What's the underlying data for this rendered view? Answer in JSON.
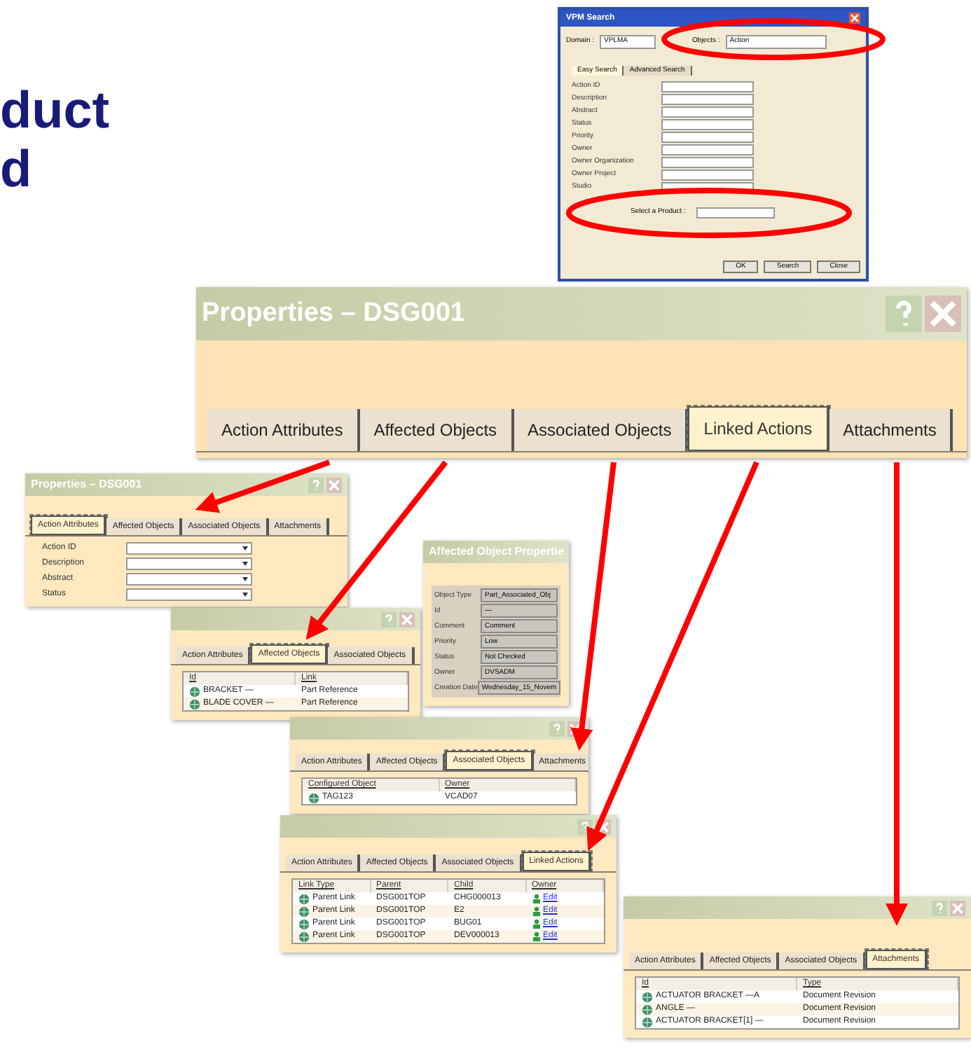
{
  "slide_title": [
    "duct",
    "d"
  ],
  "search_dialog": {
    "title": "VPM Search",
    "domain_label": "Domain :",
    "domain_value": "VPLMA",
    "objects_label": "Objects :",
    "objects_value": "Action",
    "tabs": [
      {
        "label": "Easy Search",
        "selected": true
      },
      {
        "label": "Advanced Search",
        "selected": false
      }
    ],
    "fields": [
      "Action ID",
      "Description",
      "Abstract",
      "Status",
      "Priority",
      "Owner",
      "Owner Organization",
      "Owner Project",
      "Studio"
    ],
    "product_label": "Select a Product :",
    "buttons": [
      "OK",
      "Search",
      "Close"
    ]
  },
  "windows": [
    {
      "kind": "blank",
      "title": "Properties – DSG001",
      "tabs": [
        {
          "label": "Action Attributes",
          "selected": false
        },
        {
          "label": "Affected Objects",
          "selected": false
        },
        {
          "label": "Associated Objects",
          "selected": false
        },
        {
          "label": "Linked Actions",
          "selected": true
        },
        {
          "label": "Attachments",
          "selected": false
        }
      ]
    },
    {
      "kind": "form",
      "title": "Properties – DSG001",
      "tabs": [
        {
          "label": "Action Attributes",
          "selected": true
        },
        {
          "label": "Affected Objects",
          "selected": false
        },
        {
          "label": "Associated Objects",
          "selected": false
        },
        {
          "label": "Attachments",
          "selected": false
        }
      ],
      "fields": [
        "Action ID",
        "Description",
        "Abstract",
        "Status"
      ]
    },
    {
      "kind": "table",
      "tabs": [
        {
          "label": "Action Attributes",
          "selected": false
        },
        {
          "label": "Affected Objects",
          "selected": true
        },
        {
          "label": "Associated Objects",
          "selected": false
        }
      ],
      "columns": [
        "Id",
        "Link"
      ],
      "rows": [
        {
          "cells": [
            "BRACKET —",
            "Part Reference"
          ]
        },
        {
          "cells": [
            "BLADE COVER —",
            "Part Reference"
          ]
        }
      ]
    },
    {
      "kind": "table",
      "tabs": [
        {
          "label": "Action Attributes",
          "selected": false
        },
        {
          "label": "Affected Objects",
          "selected": false
        },
        {
          "label": "Associated Objects",
          "selected": true
        },
        {
          "label": "Attachments",
          "selected": false
        }
      ],
      "columns": [
        "Configured Object",
        "Owner"
      ],
      "rows": [
        {
          "cells": [
            "TAG123",
            "VCAD07"
          ]
        }
      ]
    },
    {
      "kind": "props",
      "title": "Affected Object Propertie",
      "fields": [
        {
          "label": "Object Type",
          "value": "Part_Associated_Obj"
        },
        {
          "label": "Id",
          "value": "—"
        },
        {
          "label": "Comment",
          "value": "Comment"
        },
        {
          "label": "Priority",
          "value": "Low"
        },
        {
          "label": "Status",
          "value": "Not Checked"
        },
        {
          "label": "Owner",
          "value": "DVSADM"
        },
        {
          "label": "Creation Date",
          "value": "Wednesday_15_Novem"
        }
      ]
    },
    {
      "kind": "table",
      "tabs": [
        {
          "label": "Action Attributes",
          "selected": false
        },
        {
          "label": "Affected Objects",
          "selected": false
        },
        {
          "label": "Associated Objects",
          "selected": false
        },
        {
          "label": "Linked Actions",
          "selected": true
        }
      ],
      "columns": [
        "Link Type",
        "Parent",
        "Child",
        "Owner"
      ],
      "rows": [
        {
          "cells": [
            "Parent Link",
            "DSG001TOP",
            "CHG000013",
            "Edit"
          ]
        },
        {
          "cells": [
            "Parent Link",
            "DSG001TOP",
            "E2",
            "Edit"
          ]
        },
        {
          "cells": [
            "Parent Link",
            "DSG001TOP",
            "BUG01",
            "Edit"
          ]
        },
        {
          "cells": [
            "Parent Link",
            "DSG001TOP",
            "DEV000013",
            "Edit"
          ]
        }
      ]
    },
    {
      "kind": "table",
      "tabs": [
        {
          "label": "Action Attributes",
          "selected": false
        },
        {
          "label": "Affected Objects",
          "selected": false
        },
        {
          "label": "Associated Objects",
          "selected": false
        },
        {
          "label": "Attachments",
          "selected": true
        }
      ],
      "columns": [
        "Id",
        "Type"
      ],
      "rows": [
        {
          "cells": [
            "ACTUATOR BRACKET —A",
            "Document Revision"
          ]
        },
        {
          "cells": [
            "ANGLE —",
            "Document Revision"
          ]
        },
        {
          "cells": [
            "ACTUATOR BRACKET[1] —",
            "Document Revision"
          ]
        }
      ]
    }
  ]
}
